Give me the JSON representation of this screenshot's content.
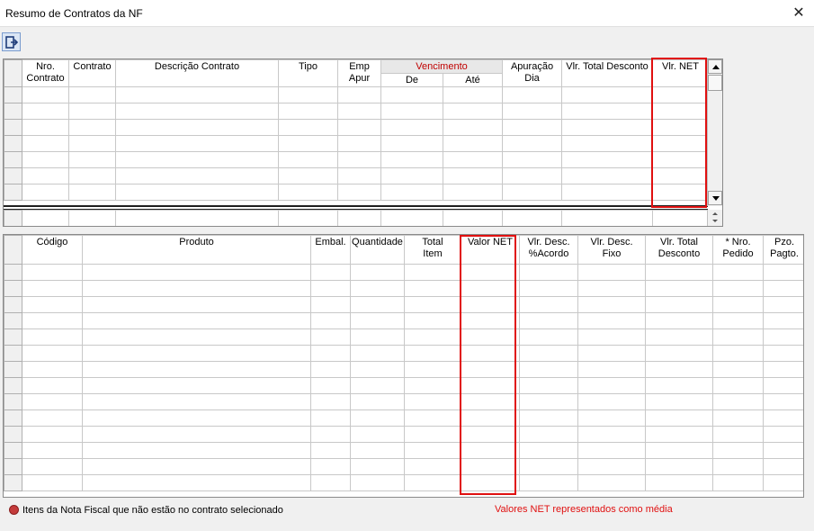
{
  "window": {
    "title": "Resumo de Contratos da NF",
    "close_glyph": "✕"
  },
  "toolbar": {
    "exit_icon": "exit-icon"
  },
  "contracts_grid": {
    "headers": {
      "nro_contrato": "Nro.\nContrato",
      "contrato": "Contrato",
      "descricao": "Descrição Contrato",
      "tipo": "Tipo",
      "emp_apur": "Emp\nApur",
      "vencimento": "Vencimento",
      "de": "De",
      "ate": "Até",
      "apuracao_dia": "Apuração\nDia",
      "vlr_total_desconto": "Vlr. Total Desconto",
      "vlr_net": "Vlr. NET"
    },
    "row_count": 7
  },
  "items_grid": {
    "headers": {
      "codigo": "Código",
      "produto": "Produto",
      "embal": "Embal.",
      "quantidade": "Quantidade",
      "total_item": "Total\nItem",
      "valor_net": "Valor NET",
      "vlr_desc_acordo": "Vlr. Desc.\n%Acordo",
      "vlr_desc_fixo": "Vlr. Desc.\nFixo",
      "vlr_total_desconto": "Vlr. Total\nDesconto",
      "nro_pedido": "* Nro.\nPedido",
      "pzo_pagto": "Pzo.\nPagto."
    },
    "row_count": 14
  },
  "footer": {
    "legend_text": "Itens da Nota Fiscal que não estão no contrato selecionado",
    "legend_color": "#c43b3b",
    "note_text": "Valores NET representados como média",
    "note_color": "#e01010"
  },
  "highlight_color": "#e01010"
}
